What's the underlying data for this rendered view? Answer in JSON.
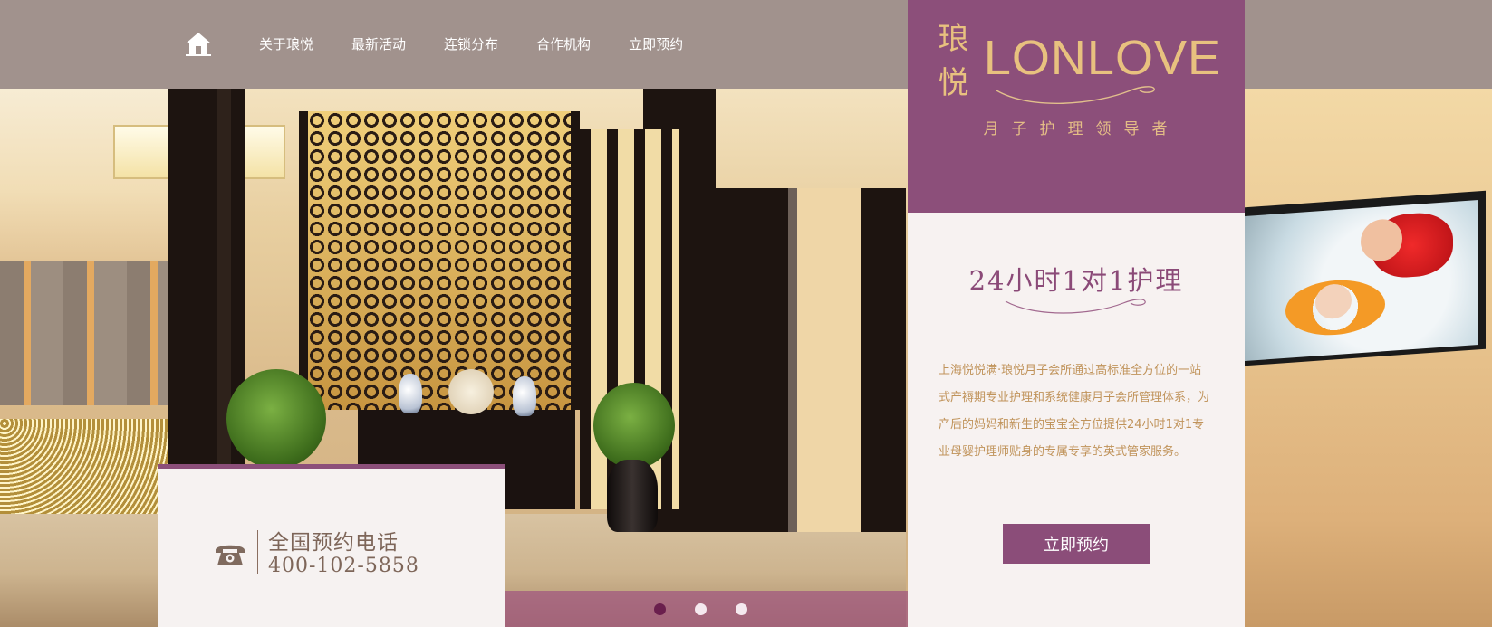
{
  "nav": {
    "items": [
      "关于琅悦",
      "最新活动",
      "连锁分布",
      "合作机构",
      "立即预约"
    ]
  },
  "brand": {
    "logo_cn": "琅悦",
    "logo_en": "LONLOVE",
    "tagline": "月子护理领导者"
  },
  "info": {
    "headline": "24小时1对1护理",
    "description": "上海悦悦满·琅悦月子会所通过高标准全方位的一站式产褥期专业护理和系统健康月子会所管理体系，为产后的妈妈和新生的宝宝全方位提供24小时1对1专业母婴护理师贴身的专属专享的英式管家服务。",
    "book_button": "立即预约"
  },
  "phone": {
    "label": "全国预约电话",
    "number": "400-102-5858"
  },
  "slider": {
    "count": 3,
    "active_index": 0
  },
  "colors": {
    "header_bg": "#a1928d",
    "brand_purple": "#8c4f7a",
    "gold": "#e8c17f",
    "panel_bg": "#f7f2f1",
    "body_text": "#c0935a"
  }
}
